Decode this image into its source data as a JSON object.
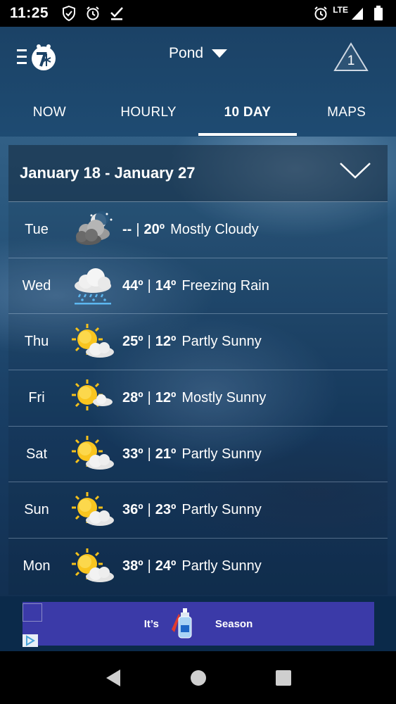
{
  "status_bar": {
    "time": "11:25",
    "network": "LTE",
    "icons": [
      "shield-icon",
      "alarm-icon",
      "check-icon",
      "alarm-icon",
      "signal-icon",
      "battery-icon"
    ]
  },
  "header": {
    "location": "Pond",
    "alert_count": "1",
    "colors": {
      "header_bg": "#1e4b72",
      "accent": "#ffffff"
    }
  },
  "tabs": [
    {
      "label": "NOW",
      "active": false
    },
    {
      "label": "HOURLY",
      "active": false
    },
    {
      "label": "10 DAY",
      "active": true
    },
    {
      "label": "MAPS",
      "active": false
    }
  ],
  "forecast": {
    "date_range": "January 18 - January 27",
    "days": [
      {
        "day": "Tue",
        "high": "--",
        "low": "20º",
        "condition": "Mostly Cloudy",
        "icon": "night-cloudy-icon"
      },
      {
        "day": "Wed",
        "high": "44º",
        "low": "14º",
        "condition": "Freezing Rain",
        "icon": "freezing-rain-icon"
      },
      {
        "day": "Thu",
        "high": "25º",
        "low": "12º",
        "condition": "Partly Sunny",
        "icon": "partly-sunny-icon"
      },
      {
        "day": "Fri",
        "high": "28º",
        "low": "12º",
        "condition": "Mostly Sunny",
        "icon": "mostly-sunny-icon"
      },
      {
        "day": "Sat",
        "high": "33º",
        "low": "21º",
        "condition": "Partly Sunny",
        "icon": "partly-sunny-icon"
      },
      {
        "day": "Sun",
        "high": "36º",
        "low": "23º",
        "condition": "Partly Sunny",
        "icon": "partly-sunny-icon"
      },
      {
        "day": "Mon",
        "high": "38º",
        "low": "24º",
        "condition": "Partly Sunny",
        "icon": "partly-sunny-icon"
      }
    ]
  },
  "ad": {
    "text_left": "It’s",
    "text_right": "Season"
  }
}
